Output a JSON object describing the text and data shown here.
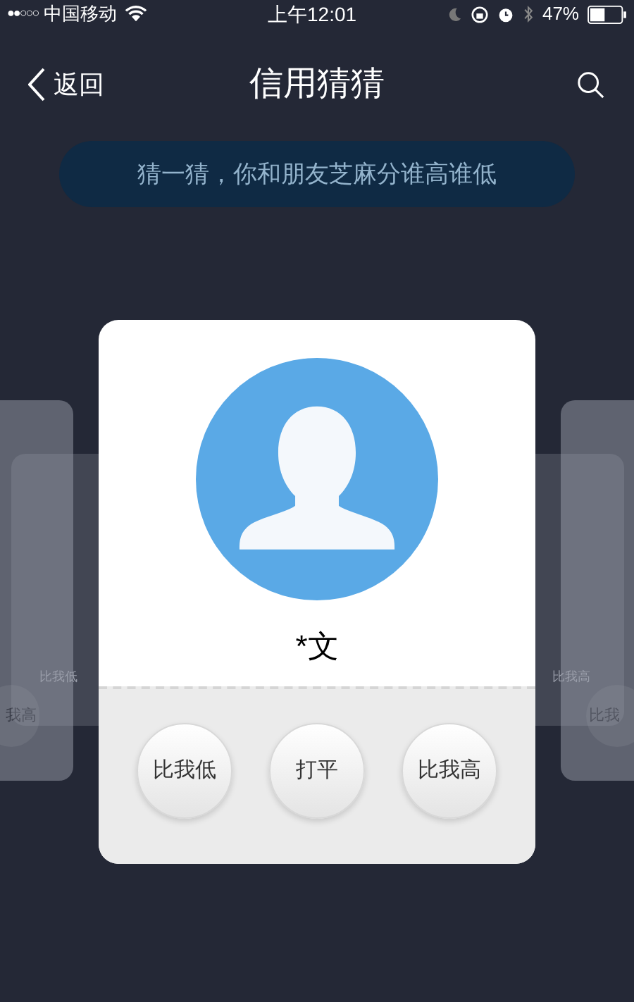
{
  "status_bar": {
    "signal": "●●○○○",
    "carrier": "中国移动",
    "time": "上午12:01",
    "battery": "47%"
  },
  "nav": {
    "back": "返回",
    "title": "信用猜猜"
  },
  "banner": "猜一猜，你和朋友芝麻分谁高谁低",
  "side_cards": [
    {
      "kind": "left-front",
      "button": "我高"
    },
    {
      "kind": "right-front",
      "button": "比我"
    },
    {
      "kind": "left-back",
      "button": "比我低"
    },
    {
      "kind": "right-back",
      "button": "比我高"
    }
  ],
  "card": {
    "name": "*文",
    "buttons": [
      "比我低",
      "打平",
      "比我高"
    ]
  }
}
